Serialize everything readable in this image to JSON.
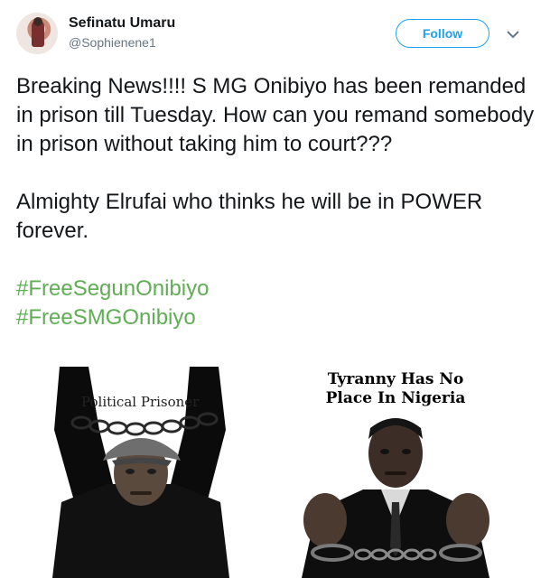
{
  "user": {
    "display_name": "Sefinatu Umaru",
    "handle": "@Sophienene1",
    "avatar_icon": "profile-photo"
  },
  "actions": {
    "follow_label": "Follow",
    "more_icon": "chevron-down-icon"
  },
  "tweet": {
    "paragraph1": "Breaking News!!!! S MG Onibiyo has been remanded in prison till Tuesday. How can you remand somebody in prison without taking him to court???",
    "paragraph2": "Almighty Elrufai who thinks he will be in POWER forever.",
    "hashtags": [
      "#FreeSegunOnibiyo",
      "#FreeSMGOnibiyo"
    ]
  },
  "media": {
    "left_caption": "Political Prisoner",
    "right_caption_line1": "Tyranny Has No",
    "right_caption_line2": "Place In Nigeria"
  },
  "colors": {
    "accent": "#1da1f2",
    "hashtag": "#5fae54",
    "secondary_text": "#657786"
  }
}
